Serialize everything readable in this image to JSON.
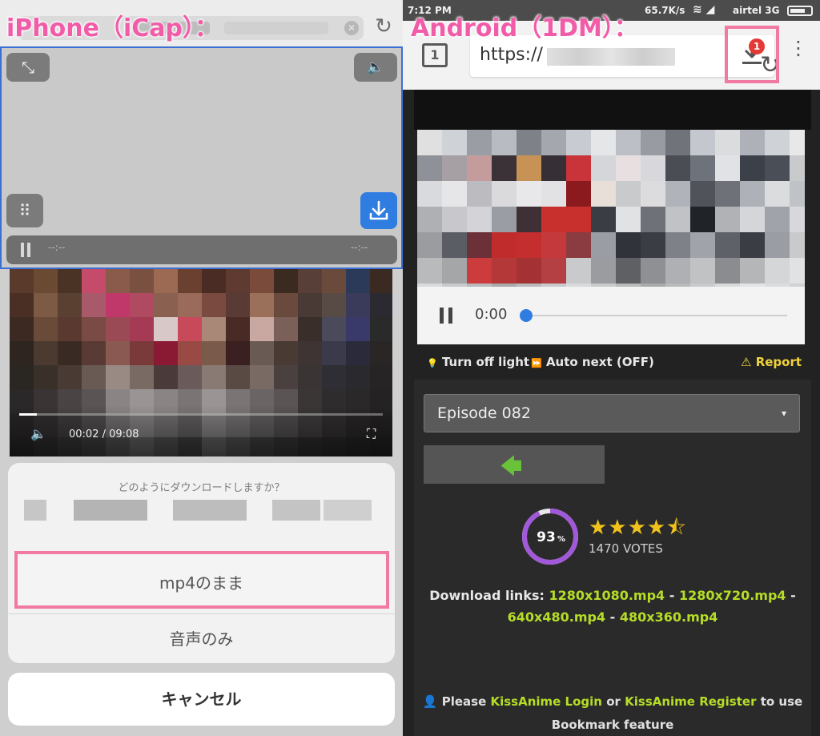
{
  "captions": {
    "left": "iPhone（iCap）：",
    "right": "Android（1DM）："
  },
  "iphone": {
    "browser": {
      "reload_glyph": "↻",
      "clear_glyph": "✕"
    },
    "player": {
      "expand_glyph": "⤡",
      "volume_glyph": "🔈",
      "grid_glyph": "⠿",
      "time_current": "--:--",
      "time_total": "--:--"
    },
    "video": {
      "time": "00:02  /  09:08",
      "volume_glyph": "🔈",
      "fullscreen_glyph": "⛶",
      "mosaic": [
        "#5a3a2a",
        "#6b4a34",
        "#4a3224",
        "#c64a6a",
        "#8a5a4a",
        "#7a5040",
        "#9c6a52",
        "#6a4030",
        "#4a2c24",
        "#5e3a30",
        "#7a4a3a",
        "#3a2a20",
        "#584038",
        "#6a4a3a",
        "#2c3a5a",
        "#3a2a22",
        "#4a3024",
        "#7c5a44",
        "#5a4030",
        "#a85a6a",
        "#c0386a",
        "#b04a60",
        "#8a6050",
        "#9a6a5a",
        "#7a4a40",
        "#5a3a34",
        "#9a705a",
        "#6a4a3c",
        "#4a3a36",
        "#584a44",
        "#3a3a5a",
        "#2a2a30",
        "#3c2a22",
        "#6a4a38",
        "#5a3a30",
        "#7a4a44",
        "#9a4a54",
        "#a43a54",
        "#d8c8c8",
        "#c84a5a",
        "#aa8878",
        "#4a2a24",
        "#c8a8a0",
        "#7a6058",
        "#3a2e2a",
        "#4a4a5a",
        "#3a3a6a",
        "#2a2a2a",
        "#2e2420",
        "#4a3a30",
        "#3a2a24",
        "#5a3a34",
        "#8a5a52",
        "#7a3a3a",
        "#8a1a34",
        "#9a4a44",
        "#7a5a4a",
        "#3a2020",
        "#6a5a54",
        "#4a3a34",
        "#3e3434",
        "#3a3a4a",
        "#2a2a3a",
        "#2a2626",
        "#2a2622",
        "#3a302a",
        "#4a3a34",
        "#6a5a54",
        "#9a8a84",
        "#7a6a64",
        "#4a3a3a",
        "#6a5a5a",
        "#8a7a74",
        "#5a4a44",
        "#7a6a64",
        "#4a4040",
        "#3a3434",
        "#2e2e34",
        "#2a2a2e",
        "#262424",
        "#2a2828",
        "#3a3434",
        "#4a4444",
        "#5a5454",
        "#8a8484",
        "#9a9494",
        "#8a8484",
        "#7a7474",
        "#9a9494",
        "#7a7474",
        "#6a6464",
        "#5a5454",
        "#3a3636",
        "#2e2c2c",
        "#2a2828",
        "#242222",
        "#262424",
        "#2e2c2c",
        "#3a3838",
        "#4a4848",
        "#6a6868",
        "#7a7878",
        "#6a6868",
        "#5a5858",
        "#7a7878",
        "#6a6868",
        "#5a5858",
        "#4a4848",
        "#3a3838",
        "#2e2c2c",
        "#262424",
        "#222020",
        "#242222",
        "#2a2828",
        "#323030",
        "#3a3838",
        "#4a4848",
        "#5a5858",
        "#4a4848",
        "#3a3838",
        "#5a5858",
        "#4a4848",
        "#3a3838",
        "#323030",
        "#2a2828",
        "#262424",
        "#222020",
        "#201e1e"
      ]
    },
    "sheet": {
      "question": "どのようにダウンロードしますか？",
      "option_mp4": "mp4のまま",
      "option_audio": "音声のみ",
      "cancel": "キャンセル"
    }
  },
  "android": {
    "status": {
      "time": "7:12 PM",
      "speed": "65.7K/s",
      "signal_glyph": "≋ ◢",
      "carrier": "airtel 3G"
    },
    "browser": {
      "tab_count": "1",
      "url": "https://",
      "reload_glyph": "↻",
      "download_badge": "1",
      "more_glyph": "⋮"
    },
    "video": {
      "time": "0:00",
      "mosaic": [
        "#e0e0e0",
        "#cfd2d6",
        "#9a9ea4",
        "#b8bcc2",
        "#7e8288",
        "#a4a8ae",
        "#c8ccd2",
        "#e4e6e8",
        "#bcc0c6",
        "#989ca2",
        "#70747a",
        "#c4c8ce",
        "#dadcde",
        "#aeb2b8",
        "#cfd2d6",
        "#e8e8e8",
        "#8e9298",
        "#a6a0a4",
        "#c49c9c",
        "#3a3236",
        "#c69256",
        "#363036",
        "#c8343a",
        "#d4d6da",
        "#e8e0e0",
        "#d8d8dc",
        "#4a4e54",
        "#6e727a",
        "#e0e2e6",
        "#3c4048",
        "#4a4e56",
        "#c8cacc",
        "#d8dade",
        "#e6e6e8",
        "#bcbcc0",
        "#dadadc",
        "#e8e8ea",
        "#e2e2e4",
        "#8a1a1e",
        "#e8e0d8",
        "#c8cacc",
        "#dcdcde",
        "#b0b4ba",
        "#50545a",
        "#6e7278",
        "#aeb2b8",
        "#dadcde",
        "#bfc2c6",
        "#aeb0b4",
        "#c8c8cc",
        "#d4d4d8",
        "#9a9ea4",
        "#3e3034",
        "#c8302e",
        "#c8302e",
        "#3a3e44",
        "#e0e2e4",
        "#6e7278",
        "#c0c2c6",
        "#202428",
        "#b0b2b6",
        "#d4d6da",
        "#a0a4aa",
        "#d8d8dc",
        "#9a9ca0",
        "#5a5e64",
        "#6c3038",
        "#c02c2c",
        "#c42e2e",
        "#c43a3c",
        "#8a3c40",
        "#9a9ea4",
        "#30343a",
        "#3a3e44",
        "#7e8288",
        "#a0a4aa",
        "#5e6268",
        "#3a3e44",
        "#9a9ea4",
        "#c8cacc",
        "#b8babc",
        "#a4a6a8",
        "#cc3c3c",
        "#b43838",
        "#a43234",
        "#b44044",
        "#c8cacc",
        "#9a9ca0",
        "#5e6064",
        "#8e9094",
        "#aeb0b4",
        "#c0c2c4",
        "#8a8c90",
        "#b4b6b8",
        "#d4d6d8",
        "#e0e2e4",
        "#d8dadc",
        "#c8cacc",
        "#b8babc",
        "#a8aaac",
        "#b8babc",
        "#c8cacc",
        "#d8dadc",
        "#c8cacc",
        "#b8babc",
        "#a8aaac",
        "#b8babc",
        "#c8cacc",
        "#d8dadc",
        "#e2e4e6",
        "#dadcde",
        "#d0d2d4"
      ]
    },
    "tools": {
      "light": "Turn off light",
      "light_glyph": "💡",
      "autonext": "Auto next (OFF)",
      "autonext_glyph": "⏩",
      "report": "Report",
      "report_glyph": "⚠"
    },
    "episode_select": {
      "value": "Episode 082",
      "caret": "▾"
    },
    "back_arrow": "🡄",
    "rating": {
      "percent_value": 93,
      "percent_label": "93",
      "percent_sign": "%",
      "stars": "★★★★⯪",
      "stars_value": 4.5,
      "votes": "1470 VOTES"
    },
    "download": {
      "prefix": "Download links: ",
      "links": [
        "1280x1080.mp4",
        "1280x720.mp4",
        "640x480.mp4",
        "480x360.mp4"
      ],
      "sep": " - "
    },
    "bookmark": {
      "pin_glyph": "👤",
      "please": " Please ",
      "login": "KissAnime Login",
      "or": " or ",
      "register": "KissAnime Register",
      "tail": " to use",
      "line2": "Bookmark feature"
    },
    "colors": {
      "accent_blue": "#2f7de1",
      "link_green": "#b5dd27",
      "report_yellow": "#f1d23b",
      "highlight_pink": "#f07aa0",
      "rating_purple": "#a259d9"
    }
  }
}
